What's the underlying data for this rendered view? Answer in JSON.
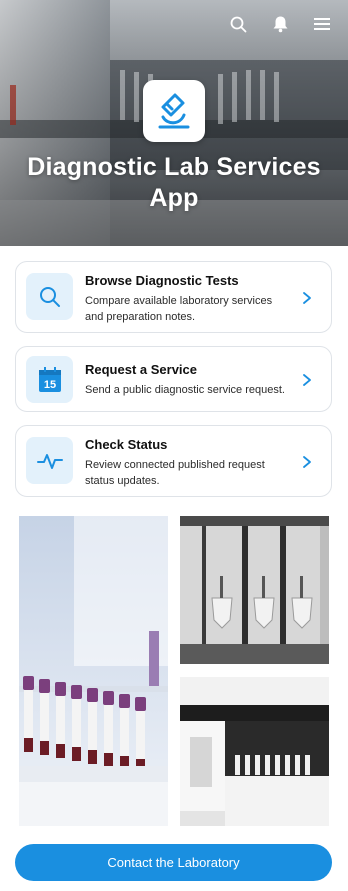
{
  "app": {
    "title": "Diagnostic Lab Services App"
  },
  "header": {
    "icons": [
      "search-icon",
      "notification-bell-icon",
      "menu-icon"
    ]
  },
  "colors": {
    "accent": "#1a8fe0",
    "icon_bg": "#e3f1fb",
    "card_border": "#dfe3e8"
  },
  "cards": [
    {
      "title": "Browse Diagnostic Tests",
      "description": "Compare available laboratory services and preparation notes.",
      "icon": "search-icon"
    },
    {
      "title": "Request a Service",
      "description": "Send a public diagnostic service request.",
      "icon": "calendar-icon",
      "icon_text": "15"
    },
    {
      "title": "Check Status",
      "description": "Review connected published request status updates.",
      "icon": "pulse-icon"
    }
  ],
  "gallery": {
    "images": [
      "blood-sample-tubes-photo",
      "restroom-urinals-photo",
      "lab-analyzer-photo"
    ]
  },
  "cta": {
    "label": "Contact the Laboratory"
  }
}
